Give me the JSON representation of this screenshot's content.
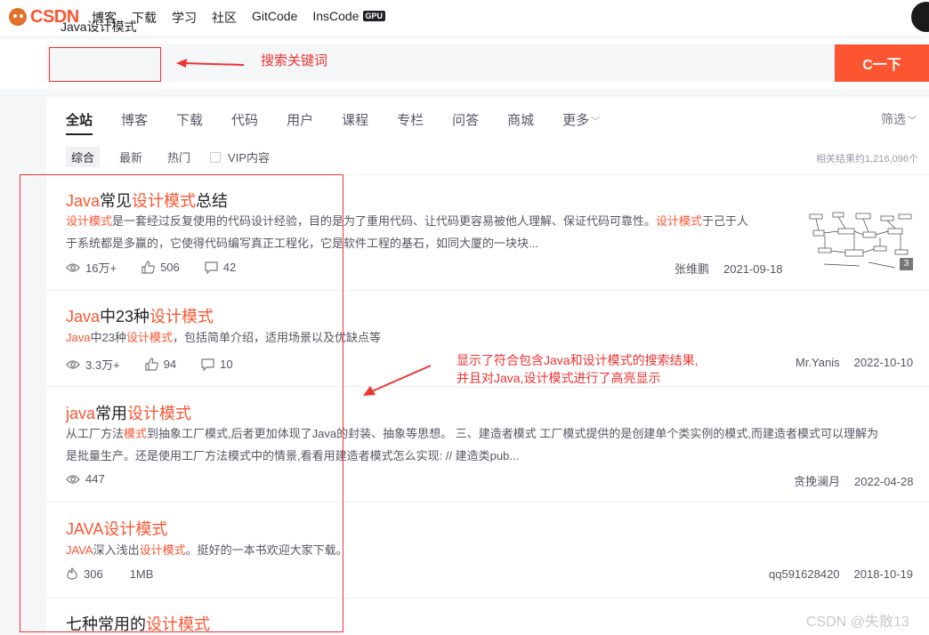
{
  "nav": {
    "logo_text": "CSDN",
    "links": [
      "博客",
      "下载",
      "学习",
      "社区",
      "GitCode",
      "InsCode"
    ],
    "gpu_badge": "GPU"
  },
  "search": {
    "query": "Java设计模式",
    "button": "C一下",
    "annotation": "搜索关键词"
  },
  "tabs": [
    "全站",
    "博客",
    "下载",
    "代码",
    "用户",
    "课程",
    "专栏",
    "问答",
    "商城",
    "更多"
  ],
  "filter_label": "筛选",
  "subtabs": [
    "综合",
    "最新",
    "热门"
  ],
  "vip_label": "VIP内容",
  "result_count": "相关结果约1,216,096个",
  "results": [
    {
      "title": [
        "Java",
        "常见",
        "设计模式",
        "总结"
      ],
      "desc1": [
        "设计模式",
        "是一套经过反复使用的代码设计经验，目的是为了重用代码、让代码更容易被他人理解、保证代码可靠性。",
        "设计模式",
        "于己于人"
      ],
      "desc2": "于系统都是多赢的，它使得代码编写真正工程化，它是软件工程的基石，如同大厦的一块块...",
      "views": "16万+",
      "likes": "506",
      "comments": "42",
      "author": "张维鹏",
      "date": "2021-09-18",
      "image_count": "3"
    },
    {
      "title": [
        "Java",
        "中23种",
        "设计模式"
      ],
      "desc1": [
        "Java",
        "中23种",
        "设计模式",
        "，包括简单介绍，适用场景以及优缺点等"
      ],
      "views": "3.3万+",
      "likes": "94",
      "comments": "10",
      "author": "Mr.Yanis",
      "date": "2022-10-10"
    },
    {
      "title": [
        "java",
        "常用",
        "设计模式"
      ],
      "desc1": [
        "从工厂方法",
        "模式",
        "到抽象工厂模式,后者更加体现了Java的封装、抽象等思想。 三、建造者模式 工厂模式提供的是创建单个类实例的模式,而建造者模式可以理解为"
      ],
      "desc2": "是批量生产。还是使用工厂方法模式中的情景,看看用建造者模式怎么实现: // 建造类pub...",
      "views": "447",
      "author": "贪挽澜月",
      "date": "2022-04-28"
    },
    {
      "title": [
        "JAVA",
        "设计模式"
      ],
      "desc1": [
        "JAVA",
        "深入浅出",
        "设计模式",
        "。挺好的一本书欢迎大家下载。"
      ],
      "hot": "306",
      "size": "1MB",
      "author": "qq591628420",
      "date": "2018-10-19"
    },
    {
      "title": [
        "七种常用的",
        "设计模式"
      ]
    }
  ],
  "annotation_results": [
    "显示了符合包含Java和设计模式的搜索结果,",
    "并且对Java,设计模式进行了高亮显示"
  ],
  "watermark": "CSDN @失散13",
  "colors": {
    "accent": "#fc5531",
    "annotation": "#e33333"
  }
}
